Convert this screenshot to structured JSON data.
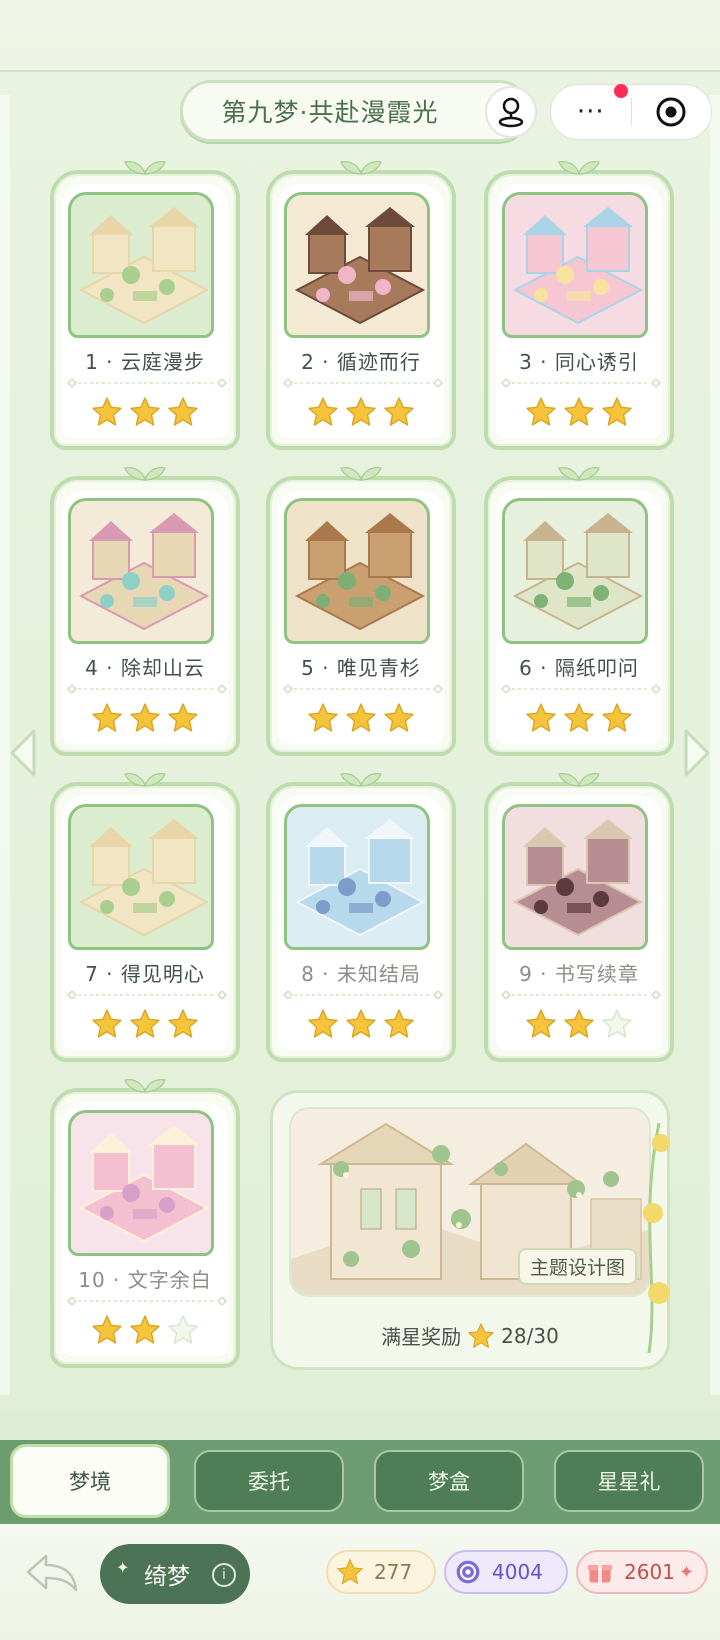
{
  "header": {
    "title": "第九梦·共赴漫霞光",
    "more_label": "···"
  },
  "levels": [
    {
      "label": "1 · 云庭漫步",
      "stars": 3,
      "muted": false,
      "palette": "green"
    },
    {
      "label": "2 · 循迹而行",
      "stars": 3,
      "muted": false,
      "palette": "wood"
    },
    {
      "label": "3 · 同心诱引",
      "stars": 3,
      "muted": false,
      "palette": "pink"
    },
    {
      "label": "4 · 除却山云",
      "stars": 3,
      "muted": false,
      "palette": "cream"
    },
    {
      "label": "5 · 唯见青杉",
      "stars": 3,
      "muted": false,
      "palette": "forest"
    },
    {
      "label": "6 · 隔纸叩问",
      "stars": 3,
      "muted": false,
      "palette": "garden"
    },
    {
      "label": "7 · 得见明心",
      "stars": 3,
      "muted": false,
      "palette": "green"
    },
    {
      "label": "8 · 未知结局",
      "stars": 3,
      "muted": true,
      "palette": "blue"
    },
    {
      "label": "9 · 书写续章",
      "stars": 2,
      "muted": true,
      "palette": "rose"
    },
    {
      "label": "10 · 文字余白",
      "stars": 2,
      "muted": true,
      "palette": "candy"
    }
  ],
  "reward": {
    "tag": "主题设计图",
    "label": "满星奖励",
    "progress": "28/30"
  },
  "tabs": [
    {
      "label": "梦境",
      "active": true
    },
    {
      "label": "委托",
      "active": false
    },
    {
      "label": "梦盒",
      "active": false
    },
    {
      "label": "星星礼",
      "active": false
    }
  ],
  "footer": {
    "name": "绮梦",
    "info_icon": "i",
    "stars_count": "277",
    "gems_count": "4004",
    "hearts_count": "2601"
  },
  "colors": {
    "accent_green": "#4c7355",
    "star_gold": "#f5c43a",
    "card_border": "#bfdcaf"
  }
}
